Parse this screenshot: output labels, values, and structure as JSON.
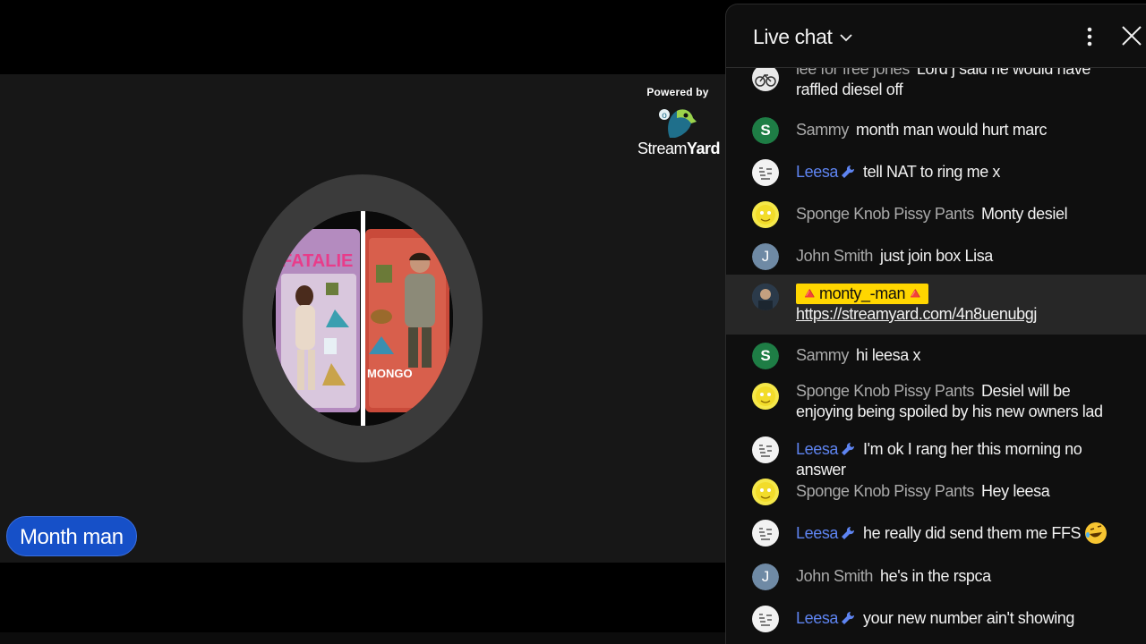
{
  "powered": {
    "label": "Powered by",
    "brand_a": "Stream",
    "brand_b": "Yard"
  },
  "name_tag": "Month man",
  "chat": {
    "title": "Live chat",
    "messages": [
      {
        "author": "lee for free jones",
        "text": "Lord j said he would have raffled diesel off",
        "avatar": "bike-avatar",
        "mod": false
      },
      {
        "author": "Sammy",
        "text": "month man would hurt marc",
        "avatar": "letter",
        "letter": "S",
        "color": "#1e7d45",
        "mod": false
      },
      {
        "author": "Leesa",
        "text": "tell NAT to ring me x",
        "avatar": "doodle-avatar",
        "mod": true
      },
      {
        "author": "Sponge Knob Pissy Pants",
        "text": "Monty desiel",
        "avatar": "yellow-avatar",
        "mod": false
      },
      {
        "author": "John Smith",
        "text": "just join box Lisa",
        "avatar": "letter",
        "letter": "J",
        "color": "#6f8aa5",
        "mod": false
      },
      {
        "author": "🔺monty_-man🔺",
        "text": "https://streamyard.com/4n8uenubgj",
        "avatar": "photo-avatar",
        "owner": true,
        "mod": false
      },
      {
        "author": "Sammy",
        "text": "hi leesa x",
        "avatar": "letter",
        "letter": "S",
        "color": "#1e7d45",
        "mod": false
      },
      {
        "author": "Sponge Knob Pissy Pants",
        "text": "Desiel will be enjoying being spoiled by his new owners lad",
        "avatar": "yellow-avatar",
        "mod": false
      },
      {
        "author": "Leesa",
        "text": "I'm ok I rang her this morning no answer",
        "avatar": "doodle-avatar",
        "mod": true
      },
      {
        "author": "Sponge Knob Pissy Pants",
        "text": "Hey leesa",
        "avatar": "yellow-avatar",
        "mod": false
      },
      {
        "author": "Leesa",
        "text": "he really did send them me FFS",
        "avatar": "doodle-avatar",
        "mod": true,
        "emoji": "rofl"
      },
      {
        "author": "John Smith",
        "text": "he's in the rspca",
        "avatar": "letter",
        "letter": "J",
        "color": "#6f8aa5",
        "mod": false
      },
      {
        "author": "Leesa",
        "text": "your new number ain't showing",
        "avatar": "doodle-avatar",
        "mod": true
      }
    ]
  },
  "colors": {
    "accent_mod": "#5e84f1",
    "owner_chip": "#ffd600",
    "name_tag": "#1650c8"
  }
}
